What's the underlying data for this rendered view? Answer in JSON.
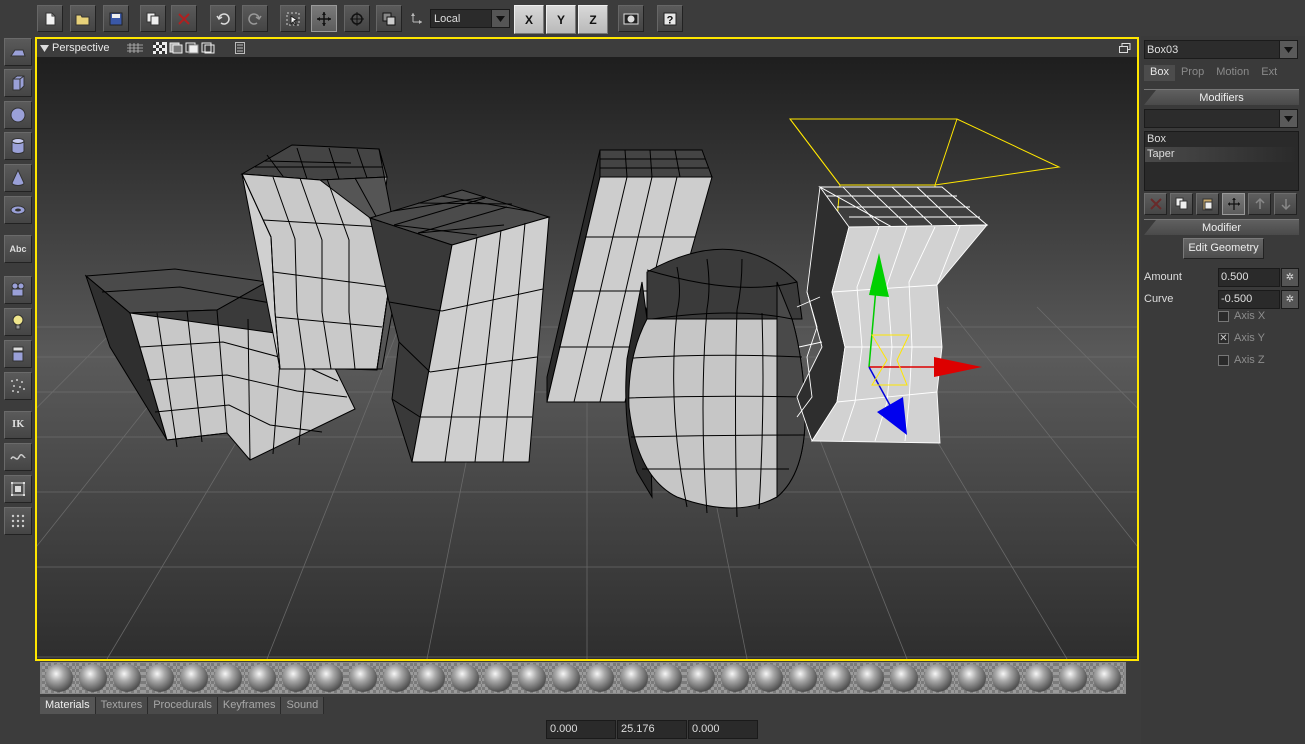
{
  "toolbar": {
    "coordinate_system": "Local",
    "axis_x": "X",
    "axis_y": "Y",
    "axis_z": "Z",
    "icons": [
      "new-file-icon",
      "open-folder-icon",
      "save-icon",
      "copy-icon",
      "delete-icon",
      "undo-icon",
      "redo-icon",
      "select-icon",
      "move-icon",
      "rotate-icon",
      "scale-icon",
      "coordinate-axis-icon",
      "render-icon",
      "help-icon"
    ]
  },
  "left_toolbar": {
    "text_button": "Abc",
    "ik_button": "IK",
    "icons": [
      "plane-icon",
      "box-icon",
      "sphere-icon",
      "cylinder-icon",
      "cone-icon",
      "torus-icon",
      "text-icon",
      "camera-icon",
      "light-icon",
      "bones-icon",
      "particles-icon",
      "ik-icon",
      "spline-icon",
      "lattice-icon",
      "dots-icon"
    ]
  },
  "viewport": {
    "title": "Perspective",
    "border_color": "#ffe600"
  },
  "materials": {
    "count": 32,
    "tabs": [
      "Materials",
      "Textures",
      "Procedurals",
      "Keyframes",
      "Sound"
    ],
    "active_tab": "Materials"
  },
  "coordinates": {
    "x": "0.000",
    "y": "25.176",
    "z": "0.000"
  },
  "right_panel": {
    "object_name": "Box03",
    "tabs": [
      "Box",
      "Prop",
      "Motion",
      "Ext"
    ],
    "active_tab": "Box",
    "modifiers_header": "Modifiers",
    "modifier_select": "",
    "modifier_stack": [
      "Box",
      "Taper"
    ],
    "selected_modifier": "Taper",
    "modifier_header": "Modifier",
    "edit_geometry_label": "Edit Geometry",
    "amount_label": "Amount",
    "amount_value": "0.500",
    "curve_label": "Curve",
    "curve_value": "-0.500",
    "axis_x_label": "Axis X",
    "axis_y_label": "Axis Y",
    "axis_z_label": "Axis Z",
    "axis_x_checked": false,
    "axis_y_checked": true,
    "axis_z_checked": false
  }
}
